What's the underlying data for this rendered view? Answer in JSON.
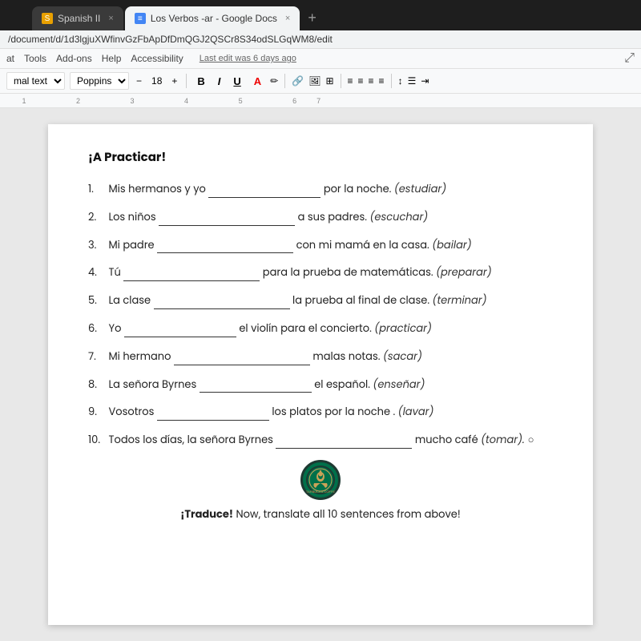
{
  "browser": {
    "tabs": [
      {
        "id": "tab-spanish",
        "label": "Spanish II",
        "icon_type": "orange",
        "icon_char": "S",
        "active": false
      },
      {
        "id": "tab-verbos",
        "label": "Los Verbos -ar - Google Docs",
        "icon_type": "blue",
        "icon_char": "≡",
        "active": true
      }
    ],
    "tab_new": "+",
    "address": "/document/d/1d3lgjuXWfinvGzFbApDfDmQGJ2QSCr8S34odSLGqWM8/edit"
  },
  "menubar": {
    "items": [
      "at",
      "Tools",
      "Add-ons",
      "Help",
      "Accessibility"
    ],
    "last_edit": "Last edit was 6 days ago"
  },
  "toolbar": {
    "style_dropdown": "mal text",
    "font_dropdown": "Poppins",
    "font_size": "18",
    "bold_label": "B",
    "italic_label": "I",
    "underline_label": "U",
    "color_label": "A"
  },
  "document": {
    "title": "¡A Practicar!",
    "exercises": [
      {
        "num": "1.",
        "before": "Mis hermanos y yo",
        "blank_class": "blank blank-medium",
        "after": "por la noche.",
        "hint": "(estudiar)"
      },
      {
        "num": "2.",
        "before": "Los niños",
        "blank_class": "blank blank-long",
        "after": "a sus padres.",
        "hint": "(escuchar)"
      },
      {
        "num": "3.",
        "before": "Mi padre",
        "blank_class": "blank blank-long",
        "after": "con mi mamá en la casa.",
        "hint": "(bailar)"
      },
      {
        "num": "4.",
        "before": "Tú",
        "blank_class": "blank blank-long",
        "after": "para la prueba de matemáticas.",
        "hint": "(preparar)"
      },
      {
        "num": "5.",
        "before": "La clase",
        "blank_class": "blank blank-long",
        "after": "la prueba al final de clase.",
        "hint": "(terminar)"
      },
      {
        "num": "6.",
        "before": "Yo",
        "blank_class": "blank blank-medium",
        "after": "el violín para el concierto.",
        "hint": "(practicar)"
      },
      {
        "num": "7.",
        "before": "Mi hermano",
        "blank_class": "blank blank-long",
        "after": "malas notas.",
        "hint": "(sacar)"
      },
      {
        "num": "8.",
        "before": "La señora Byrnes",
        "blank_class": "blank blank-medium",
        "after": "el español.",
        "hint": "(enseñar)"
      },
      {
        "num": "9.",
        "before": "Vosotros",
        "blank_class": "blank blank-medium",
        "after": "los platos por la noche .",
        "hint": "(lavar)"
      },
      {
        "num": "10.",
        "before": "Todos los días, la señora Byrnes",
        "blank_class": "blank blank-long",
        "after": "mucho café",
        "hint": "(tomar). ○"
      }
    ],
    "translate_prefix": "¡Traduce!",
    "translate_text": " Now, translate all 10 sentences from above!"
  }
}
